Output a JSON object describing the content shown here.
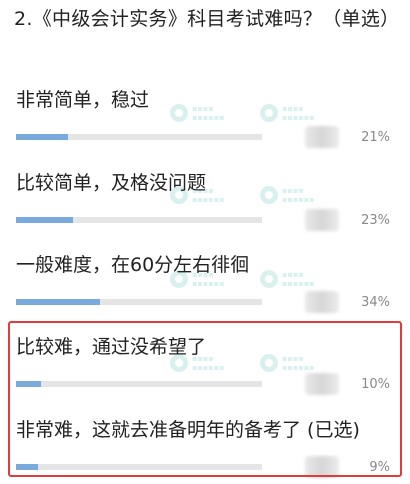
{
  "question": {
    "title": "2.《中级会计实务》科目考试难吗？（单选）"
  },
  "options": [
    {
      "label": "非常简单，稳过",
      "percent_text": "21%",
      "fill_fraction": 0.21
    },
    {
      "label": "比较简单，及格没问题",
      "percent_text": "23%",
      "fill_fraction": 0.23
    },
    {
      "label": "一般难度，在60分左右徘徊",
      "percent_text": "34%",
      "fill_fraction": 0.34
    },
    {
      "label": "比较难，通过没希望了",
      "percent_text": "10%",
      "fill_fraction": 0.1
    },
    {
      "label": "非常难，这就去准备明年的备考了 (已选)",
      "percent_text": "9%",
      "fill_fraction": 0.09
    }
  ],
  "watermark": {
    "logo_icon": "logo-circle-icon"
  },
  "colors": {
    "bar_fill": "#7aa9dc",
    "bar_track": "#e5e5e5",
    "highlight_border": "#e23b3b",
    "watermark": "#2bb6a8"
  }
}
